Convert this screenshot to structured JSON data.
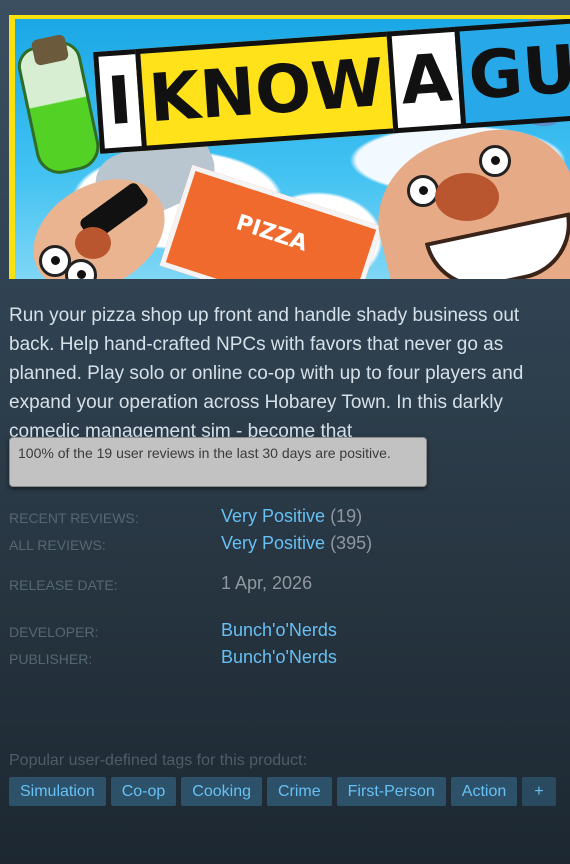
{
  "capsule": {
    "logo_parts": [
      "I",
      "KNOW",
      "A",
      "GUY"
    ],
    "pizza_label": "PIZZA"
  },
  "description": "Run your pizza shop up front and handle shady business out back. Help hand-crafted NPCs with favors that never go as planned. Play solo or online co-op with up to four players and expand your operation across Hobarey Town. In this darkly comedic management sim - become that",
  "tooltip": "100% of the 19 user reviews in the last 30 days are positive.",
  "reviews": {
    "recent_label": "RECENT REVIEWS:",
    "recent_rating": "Very Positive",
    "recent_count": "(19)",
    "all_label": "ALL REVIEWS:",
    "all_rating": "Very Positive",
    "all_count": "(395)"
  },
  "release": {
    "label": "RELEASE DATE:",
    "date": "1 Apr, 2026"
  },
  "developer": {
    "label": "DEVELOPER:",
    "name": "Bunch'o'Nerds"
  },
  "publisher": {
    "label": "PUBLISHER:",
    "name": "Bunch'o'Nerds"
  },
  "tags": {
    "label": "Popular user-defined tags for this product:",
    "items": [
      "Simulation",
      "Co-op",
      "Cooking",
      "Crime",
      "First-Person",
      "Action"
    ],
    "more": "+"
  },
  "colors": {
    "link": "#66c0f4",
    "label": "#556772",
    "tag_bg": "#2c5168",
    "tooltip_bg": "#c2c2c2"
  }
}
